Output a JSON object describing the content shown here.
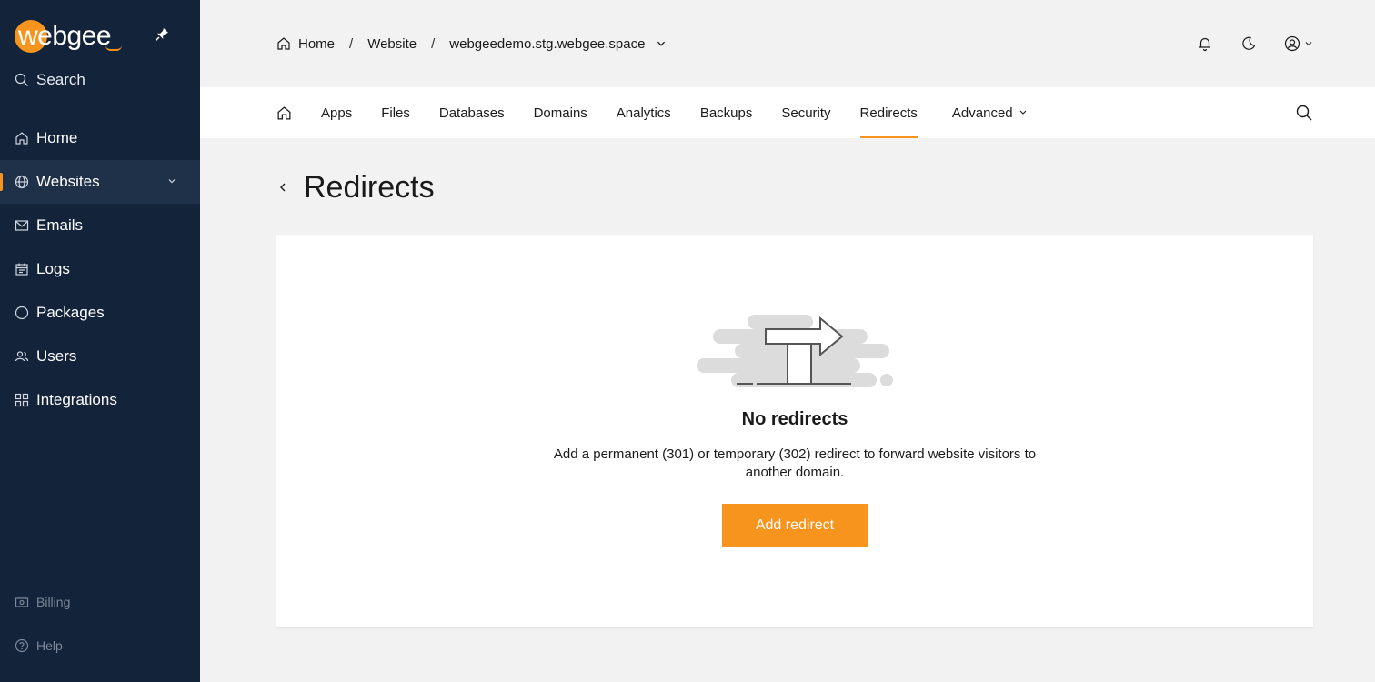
{
  "brand": {
    "logo_text": "webgee",
    "accent_color": "#f7941d",
    "sidebar_bg": "#13233a"
  },
  "sidebar": {
    "search_label": "Search",
    "items": [
      {
        "label": "Home",
        "icon": "home-icon"
      },
      {
        "label": "Websites",
        "icon": "globe-icon",
        "active": true
      },
      {
        "label": "Emails",
        "icon": "mail-icon"
      },
      {
        "label": "Logs",
        "icon": "calendar-icon"
      },
      {
        "label": "Packages",
        "icon": "circle-icon"
      },
      {
        "label": "Users",
        "icon": "users-icon"
      },
      {
        "label": "Integrations",
        "icon": "grid-icon"
      }
    ],
    "footer": {
      "billing": "Billing",
      "help": "Help"
    }
  },
  "header": {
    "breadcrumb": [
      "Home",
      "Website",
      "webgeedemo.stg.webgee.space"
    ],
    "separator": "/"
  },
  "tabs": [
    "Apps",
    "Files",
    "Databases",
    "Domains",
    "Analytics",
    "Backups",
    "Security",
    "Redirects",
    "Advanced"
  ],
  "page": {
    "title": "Redirects"
  },
  "empty_state": {
    "title": "No redirects",
    "description": "Add a permanent (301) or temporary (302) redirect to forward website visitors to another domain.",
    "button_label": "Add redirect"
  }
}
